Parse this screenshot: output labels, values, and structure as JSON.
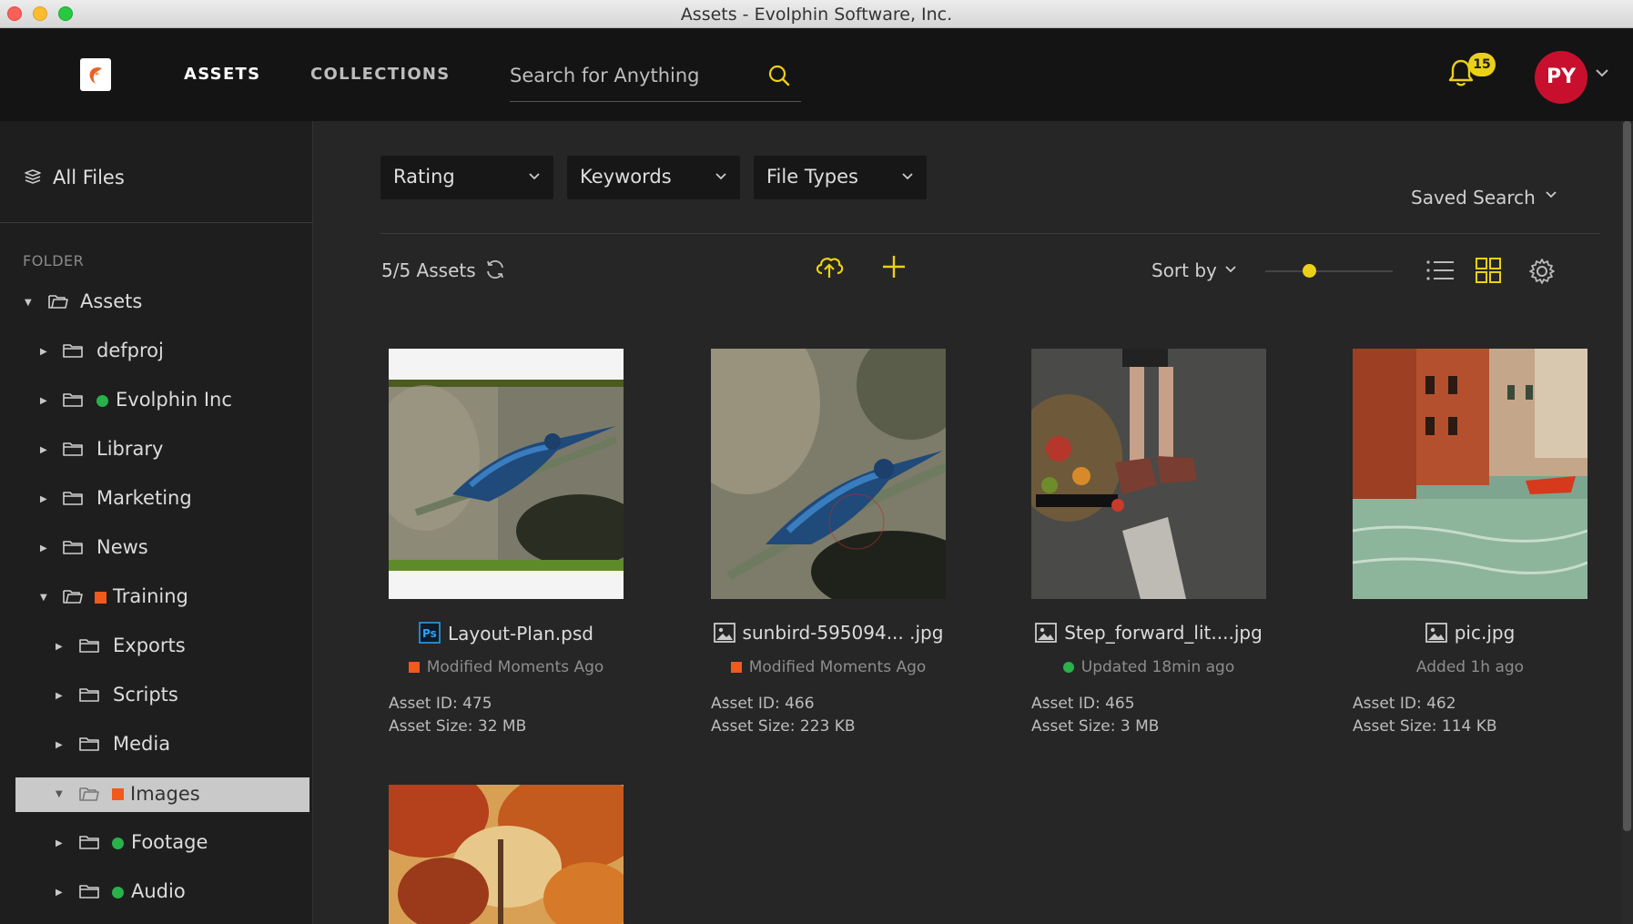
{
  "window": {
    "title": "Assets - Evolphin Software, Inc."
  },
  "topnav": {
    "tabs": [
      {
        "label": "ASSETS"
      },
      {
        "label": "COLLECTIONS"
      }
    ],
    "search_placeholder": "Search for Anything",
    "notification_count": "15",
    "user_initials": "PY",
    "colors": {
      "accent": "#ecd018",
      "avatar": "#c8102e",
      "nav_bg": "#141414"
    }
  },
  "sidebar": {
    "all_files": "All Files",
    "folder_header": "FOLDER",
    "tree": [
      {
        "label": "Assets"
      },
      {
        "label": "defproj"
      },
      {
        "label": "Evolphin Inc",
        "marker": "green-dot"
      },
      {
        "label": "Library"
      },
      {
        "label": "Marketing"
      },
      {
        "label": "News"
      },
      {
        "label": "Training",
        "marker": "orange-square"
      },
      {
        "label": "Exports"
      },
      {
        "label": "Scripts"
      },
      {
        "label": "Media"
      },
      {
        "label": "Images",
        "marker": "orange-square",
        "selected": true
      },
      {
        "label": "Footage",
        "marker": "green-dot"
      },
      {
        "label": "Audio",
        "marker": "green-dot"
      }
    ]
  },
  "main": {
    "filters": [
      {
        "label": "Rating"
      },
      {
        "label": "Keywords"
      },
      {
        "label": "File Types"
      }
    ],
    "saved_search": "Saved Search",
    "asset_count": "5/5 Assets",
    "sort_label": "Sort by",
    "thumbnail_size_fraction": 0.32,
    "assets": [
      {
        "name": "Layout-Plan.psd",
        "type_icon": "photoshop-icon",
        "status": "Modified Moments Ago",
        "status_color": "#f05a1a",
        "asset_id": "Asset ID: 475",
        "asset_size": "Asset Size: 32 MB"
      },
      {
        "name": "sunbird-595094... .jpg",
        "type_icon": "image-icon",
        "status": "Modified Moments Ago",
        "status_color": "#f05a1a",
        "asset_id": "Asset ID: 466",
        "asset_size": "Asset Size: 223 KB"
      },
      {
        "name": "Step_forward_lit....jpg",
        "type_icon": "image-icon",
        "status": "Updated 18min ago",
        "status_color": "#27b24a",
        "asset_id": "Asset ID: 465",
        "asset_size": "Asset Size: 3 MB"
      },
      {
        "name": "pic.jpg",
        "type_icon": "image-icon",
        "status": "Added 1h ago",
        "status_color": "",
        "asset_id": "Asset ID: 462",
        "asset_size": "Asset Size: 114 KB"
      }
    ]
  }
}
